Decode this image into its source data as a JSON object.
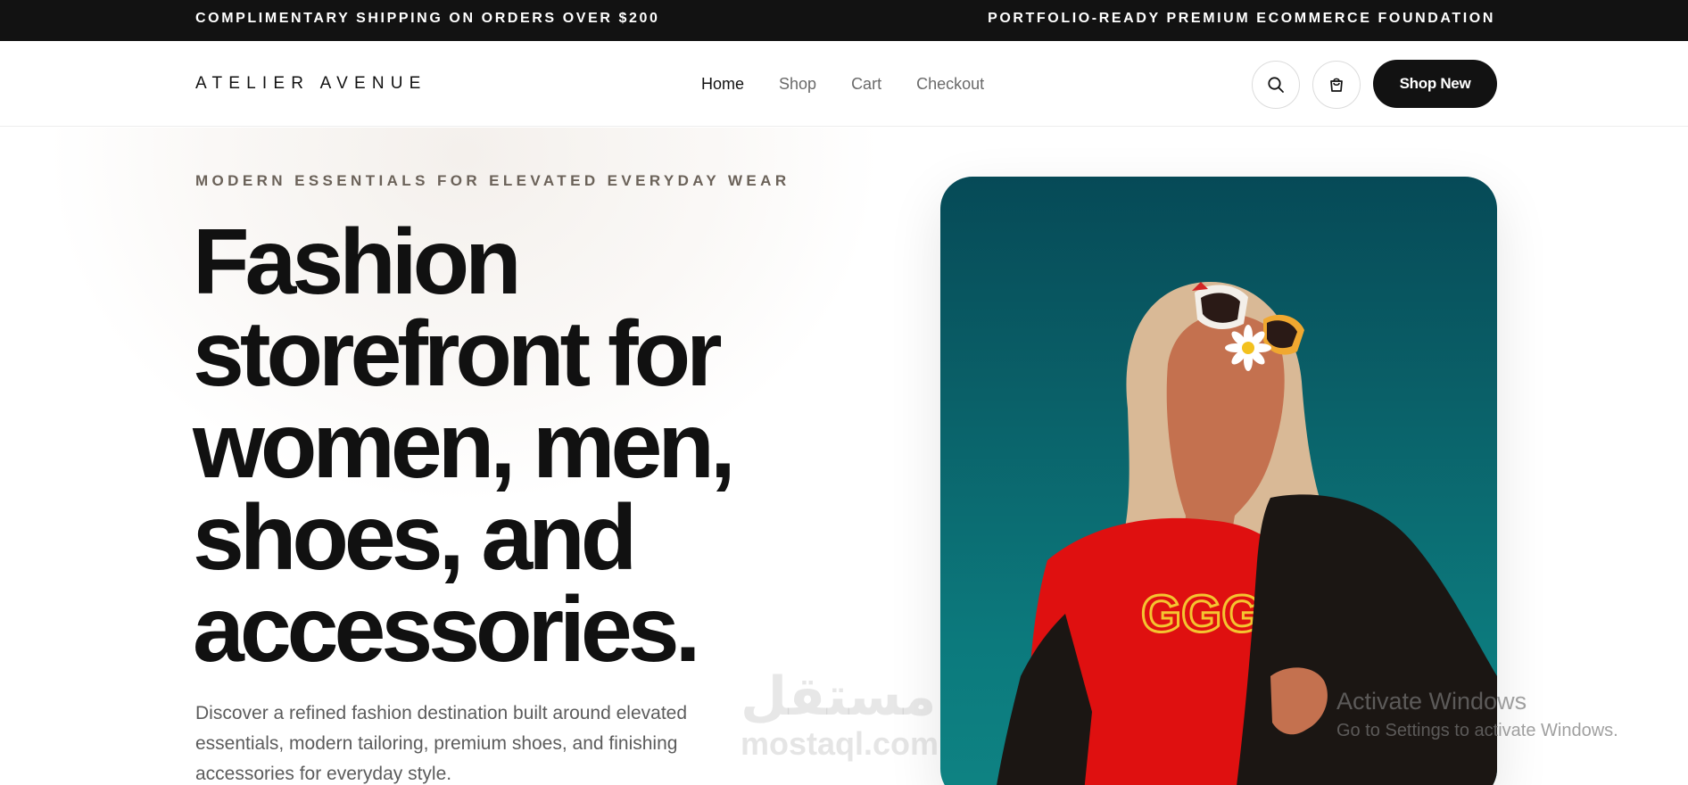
{
  "announcement": {
    "left": "COMPLIMENTARY SHIPPING ON ORDERS OVER $200",
    "right": "PORTFOLIO-READY PREMIUM ECOMMERCE FOUNDATION"
  },
  "header": {
    "logo": "ATELIER AVENUE",
    "nav": [
      {
        "label": "Home",
        "active": true
      },
      {
        "label": "Shop",
        "active": false
      },
      {
        "label": "Cart",
        "active": false
      },
      {
        "label": "Checkout",
        "active": false
      }
    ],
    "search_icon": "search-icon",
    "cart_icon": "shopping-bag-icon",
    "cta_label": "Shop New"
  },
  "hero": {
    "eyebrow": "MODERN ESSENTIALS FOR ELEVATED EVERYDAY WEAR",
    "headline_lines": [
      "Fashion",
      "storefront for",
      "women, men,",
      "shoes, and",
      "accessories."
    ],
    "subtitle_lines": [
      "Discover a refined fashion destination built around elevated",
      "essentials, modern tailoring, premium shoes, and finishing",
      "accessories for everyday style."
    ]
  },
  "watermark": {
    "arabic": "مستقل",
    "latin": "mostaql.com"
  },
  "windows_notice": {
    "title": "Activate Windows",
    "subtitle": "Go to Settings to activate Windows."
  },
  "colors": {
    "dark": "#121212",
    "teal": "#0c7a7d",
    "muted_text": "#6b6259"
  }
}
